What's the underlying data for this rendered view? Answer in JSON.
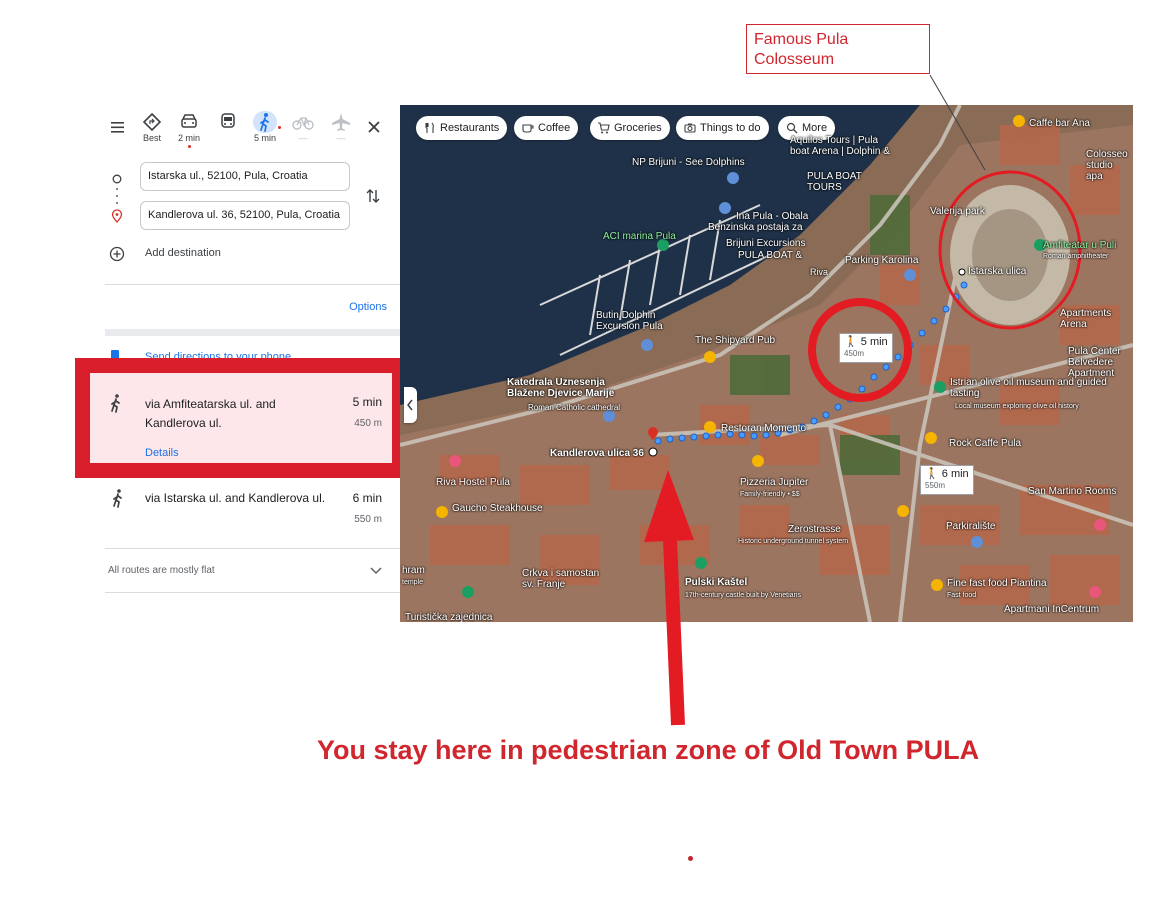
{
  "annotation": {
    "callout": "Famous Pula\nColosseum",
    "caption": "You stay here in pedestrian zone of Old Town PULA"
  },
  "panel": {
    "modes": [
      {
        "name": "best",
        "label": "Best"
      },
      {
        "name": "drive",
        "label": "2 min"
      },
      {
        "name": "transit",
        "label": ""
      },
      {
        "name": "walk",
        "label": "5 min"
      },
      {
        "name": "bike",
        "label": "—"
      },
      {
        "name": "flight",
        "label": "—"
      }
    ],
    "origin": "Istarska ul., 52100, Pula, Croatia",
    "destination": "Kandlerova ul. 36, 52100, Pula, Croatia",
    "add_destination": "Add destination",
    "options": "Options",
    "send_directions": "Send directions to your phone",
    "routes": [
      {
        "via": "via Amfiteatarska ul. and Kandlerova ul.",
        "time": "5 min",
        "distance": "450 m",
        "details": "Details"
      },
      {
        "via": "via Istarska ul. and Kandlerova ul.",
        "time": "6 min",
        "distance": "550 m"
      }
    ],
    "footer": "All routes are mostly flat"
  },
  "map": {
    "chips": [
      {
        "icon": "fork-knife-icon",
        "label": "Restaurants"
      },
      {
        "icon": "coffee-icon",
        "label": "Coffee"
      },
      {
        "icon": "cart-icon",
        "label": "Groceries"
      },
      {
        "icon": "camera-icon",
        "label": "Things to do"
      },
      {
        "icon": "search-icon",
        "label": "More"
      }
    ],
    "labels": {
      "caffe_bar_ana": "Caffe bar Ana",
      "cassiel_studio": "Colosseo studio apa",
      "aquilos": "Aquilos Tours | Pula boat Arena | Dolphin &",
      "np_brijuni": "NP Brijuni - See Dolphins",
      "pula_boat_tours": "PULA BOAT TOURS",
      "valeria_park": "Valerija park",
      "aci_marina": "ACI marina Pula",
      "ina_pula": "Ina Pula - Obala",
      "ina_sub": "Benzinska postaja za",
      "brijuni_exc": "Brijuni Excursions",
      "pula_boat_and": "PULA BOAT &",
      "amfiteatar": "Amfiteatar u Puli",
      "amfiteatar_sub": "Roman amphitheater",
      "parking_karolina": "Parking Karolina",
      "istarska_ulica": "Istarska ulica",
      "riva": "Riva",
      "butin_dolphin": "Butin Dolphin Excursion Pula",
      "shipyard_pub": "The Shipyard Pub",
      "apartments": "Apartments Arena",
      "pula_center": "Pula Center Belvedere Apartment",
      "katedrala": "Katedrala Uznesenja Blažene Djevice Marije",
      "katedrala_sub": "Roman Catholic cathedral",
      "restoran_momento": "Restoran Momento",
      "istrian_olive": "Istrian olive oil museum and guided tasting",
      "istrian_olive_sub": "Local museum exploring olive oil history",
      "rock_caffe": "Rock Caffe Pula",
      "kandlerova": "Kandlerova ulica 36",
      "riva_hostel": "Riva Hostel Pula",
      "pizzeria_jupiter": "Pizzeria Jupiter",
      "pizzeria_sub": "Family-friendly • $$",
      "san_martino": "San Martino Rooms",
      "gaucho": "Gaucho Steakhouse",
      "zerostrasse": "Zerostrasse",
      "zerostrasse_sub": "Historic underground tunnel system",
      "parkiraliste": "Parkiralište",
      "crkva": "Crkva i samostan sv. Franje",
      "pulski_kastel": "Pulski Kaštel",
      "pulski_sub": "17th-century castle built by Venetians",
      "fine_fast_food": "Fine fast food Piantina",
      "fine_sub": "Fast food",
      "apartmani": "Apartmani InCentrum",
      "turisticka": "Turistička zajednica",
      "hram": "hram",
      "hram_sub": "temple"
    },
    "walk_time_1": {
      "time": "5 min",
      "dist": "450m"
    },
    "walk_time_2": {
      "time": "6 min",
      "dist": "550m"
    }
  }
}
